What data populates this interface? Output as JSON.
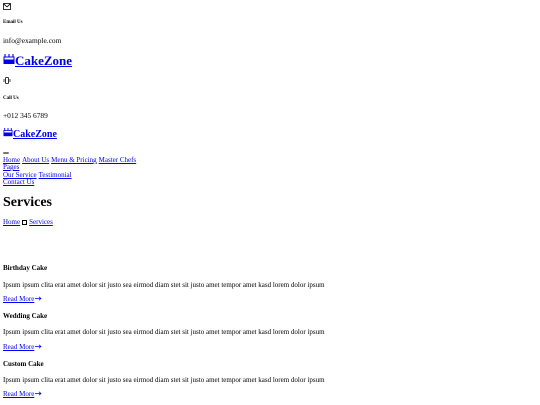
{
  "topbar": {
    "email_label": "Email Us",
    "email_value": "info@example.com",
    "email_icon": "envelope-icon",
    "phone_label": "Call Us",
    "phone_value": "+012 345 6789",
    "phone_icon": "phone-vibrate-icon"
  },
  "brand": {
    "name": "CakeZone",
    "icon": "cake-icon"
  },
  "nav": {
    "toggler_icon": "menu-toggler-icon",
    "items": [
      "Home",
      "About Us",
      "Menu & Pricing",
      "Master Chefs",
      "Pages",
      "Our Service",
      "Testimonial",
      "Contact Us"
    ]
  },
  "page": {
    "title": "Services",
    "breadcrumb": {
      "home": "Home",
      "current": "Services"
    }
  },
  "services": [
    {
      "title": "Birthday Cake",
      "text": "Ipsum ipsum clita erat amet dolor sit justo sea eirmod diam stet sit justo amet tempor amet kasd lorem dolor ipsum",
      "link": "Read More"
    },
    {
      "title": "Wedding Cake",
      "text": "Ipsum ipsum clita erat amet dolor sit justo sea eirmod diam stet sit justo amet tempor amet kasd lorem dolor ipsum",
      "link": "Read More"
    },
    {
      "title": "Custom Cake",
      "text": "Ipsum ipsum clita erat amet dolor sit justo sea eirmod diam stet sit justo amet tempor amet kasd lorem dolor ipsum",
      "link": "Read More"
    }
  ]
}
